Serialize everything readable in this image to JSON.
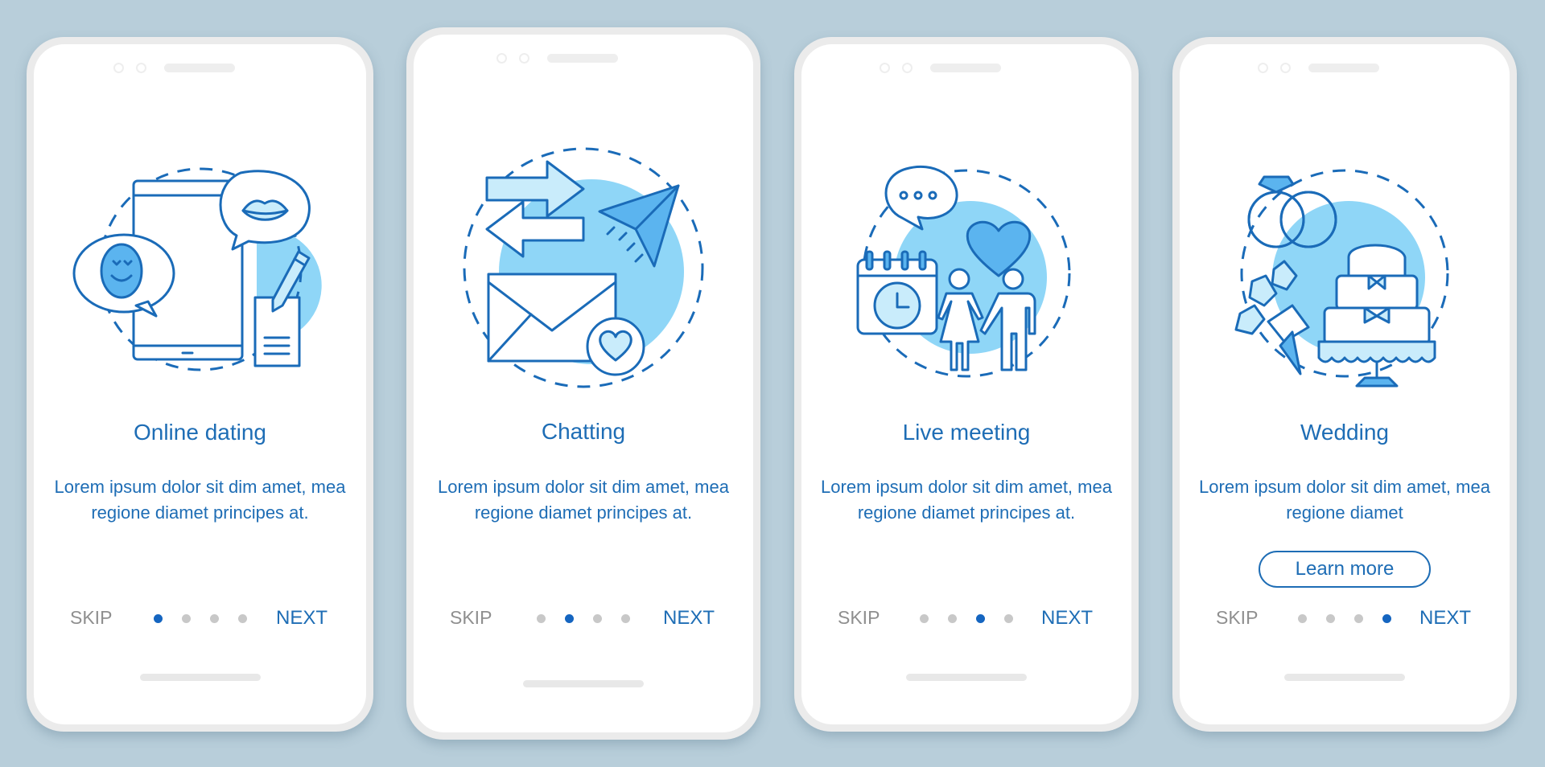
{
  "colors": {
    "background": "#b8ceda",
    "accent": "#1e6db5",
    "active_dot": "#1565c0",
    "inactive_dot": "#c8c8c8",
    "skip_text": "#8f8f8f",
    "illustration_fill": "#8fd6f7"
  },
  "screens": [
    {
      "title": "Online dating",
      "body": "Lorem ipsum dolor sit dim amet, mea regione diamet principes at.",
      "illustration": "online-dating-illustration",
      "skip_label": "SKIP",
      "next_label": "NEXT",
      "page_index": 1,
      "page_count": 4
    },
    {
      "title": "Chatting",
      "body": "Lorem ipsum dolor sit dim amet, mea regione diamet principes at.",
      "illustration": "chatting-illustration",
      "skip_label": "SKIP",
      "next_label": "NEXT",
      "page_index": 2,
      "page_count": 4
    },
    {
      "title": "Live meeting",
      "body": "Lorem ipsum dolor sit dim amet, mea regione diamet principes at.",
      "illustration": "live-meeting-illustration",
      "skip_label": "SKIP",
      "next_label": "NEXT",
      "page_index": 3,
      "page_count": 4
    },
    {
      "title": "Wedding",
      "body": "Lorem ipsum dolor sit dim amet, mea regione diamet",
      "illustration": "wedding-illustration",
      "button_label": "Learn more",
      "skip_label": "SKIP",
      "next_label": "NEXT",
      "page_index": 4,
      "page_count": 4
    }
  ]
}
